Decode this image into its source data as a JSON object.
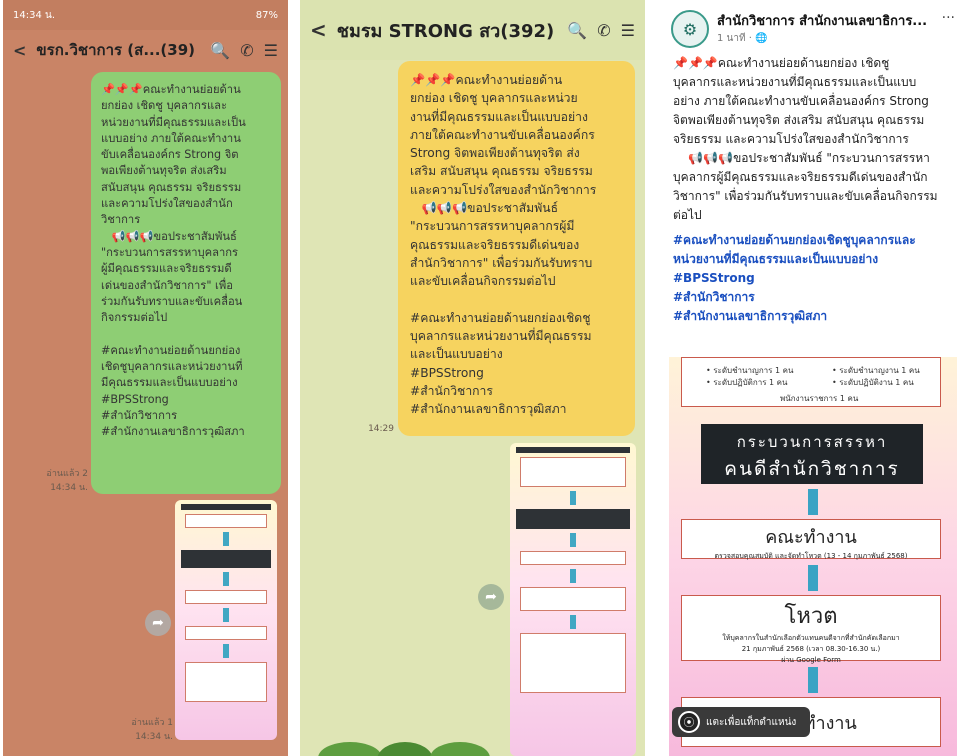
{
  "panel1": {
    "status": {
      "time": "14:34 น.",
      "right": "87%"
    },
    "header": {
      "back": "<",
      "title": "ขรก.วิชาการ (ส...(39)"
    },
    "message": "📌📌📌คณะทำงานย่อยด้าน\nยกย่อง เชิดชู บุคลากรและ\nหน่วยงานที่มีคุณธรรมและเป็น\nแบบอย่าง ภายใต้คณะทำงาน\nขับเคลื่อนองค์กร Strong จิต\nพอเพียงต้านทุจริต ส่งเสริม\nสนับสนุน คุณธรรม จริยธรรม\nและความโปร่งใสของสำนัก\nวิชาการ\n   📢📢📢ขอประชาสัมพันธ์\n\"กระบวนการสรรหาบุคลากร\nผู้มีคุณธรรมและจริยธรรมดี\nเด่นของสำนักวิชาการ\" เพื่อ\nร่วมกันรับทราบและขับเคลื่อน\nกิจกรรมต่อไป\n\n#คณะทำงานย่อยด้านยกย่อง\nเชิดชูบุคลากรและหน่วยงานที่\nมีคุณธรรมและเป็นแบบอย่าง\n#BPSStrong\n#สำนักวิชาการ\n#สำนักงานเลขาธิการวุฒิสภา",
    "read1": "อ่านแล้ว 2",
    "time1": "14:34 น.",
    "read2": "อ่านแล้ว 1",
    "time2": "14:34 น."
  },
  "panel2": {
    "header": {
      "back": "<",
      "title": "ชมรม STRONG สว(392)"
    },
    "message": "📌📌📌คณะทำงานย่อยด้าน\nยกย่อง เชิดชู บุคลากรและหน่วย\nงานที่มีคุณธรรมและเป็นแบบอย่าง\nภายใต้คณะทำงานขับเคลื่อนองค์กร\nStrong จิตพอเพียงต้านทุจริต ส่ง\nเสริม สนับสนุน คุณธรรม จริยธรรม\nและความโปร่งใสของสำนักวิชาการ\n   📢📢📢ขอประชาสัมพันธ์\n\"กระบวนการสรรหาบุคลากรผู้มี\nคุณธรรมและจริยธรรมดีเด่นของ\nสำนักวิชาการ\" เพื่อร่วมกันรับทราบ\nและขับเคลื่อนกิจกรรมต่อไป\n\n#คณะทำงานย่อยด้านยกย่องเชิดชู\nบุคลากรและหน่วยงานที่มีคุณธรรม\nและเป็นแบบอย่าง\n#BPSStrong\n#สำนักวิชาการ\n#สำนักงานเลขาธิการวุฒิสภา",
    "time": "14:29"
  },
  "panel3": {
    "page_name": "สำนักวิชาการ สำนักงานเลขาธิการ...",
    "post_time": "1 นาที · ",
    "post_text": "📌📌📌คณะทำงานย่อยด้านยกย่อง เชิดชู\nบุคลากรและหน่วยงานที่มีคุณธรรมและเป็นแบบ\nอย่าง ภายใต้คณะทำงานขับเคลื่อนองค์กร Strong\nจิตพอเพียงต้านทุจริต ส่งเสริม สนับสนุน คุณธรรม\nจริยธรรม และความโปร่งใสของสำนักวิชาการ\n    📢📢📢ขอประชาสัมพันธ์ \"กระบวนการสรรหา\nบุคลากรผู้มีคุณธรรมและจริยธรรมดีเด่นของสำนัก\nวิชาการ\" เพื่อร่วมกันรับทราบและขับเคลื่อนกิจกรรม\nต่อไป",
    "hashtags": "#คณะทำงานย่อยด้านยกย่องเชิดชูบุคลากรและ\nหน่วยงานที่มีคุณธรรมและเป็นแบบอย่าง\n#BPSStrong\n#สำนักวิชาการ\n#สำนักงานเลขาธิการวุฒิสภา",
    "poster": {
      "lvl1": "• ระดับชำนาญการ 1 คน",
      "lvl2": "• ระดับปฏิบัติการ 1 คน",
      "lvl3": "• ระดับชำนาญงาน 1 คน",
      "lvl4": "• ระดับปฏิบัติงาน 1 คน",
      "lvl5": "พนักงานราชการ 1 คน",
      "band1": "กระบวนการสรรหา",
      "band2": "คนดีสำนักวิชาการ",
      "step1": "คณะทำงาน",
      "step1_desc": "ตรวจสอบคุณสมบัติ และจัดทำโหวต (13 - 14 กุมภาพันธ์ 2568)",
      "step2": "โหวต",
      "step2_desc1": "ให้บุคลากรในสำนักเลือกตัวแทนคนดีจากที่สำนักคัดเลือกมา",
      "step2_desc2": "21 กุมภาพันธ์ 2568 (เวลา 08.30-16.30 น.)",
      "step2_desc3": "ผ่าน Google Form",
      "step3": "คณะทำงาน"
    },
    "map_chip": "แตะเพื่อแท็กตำแหน่ง"
  }
}
